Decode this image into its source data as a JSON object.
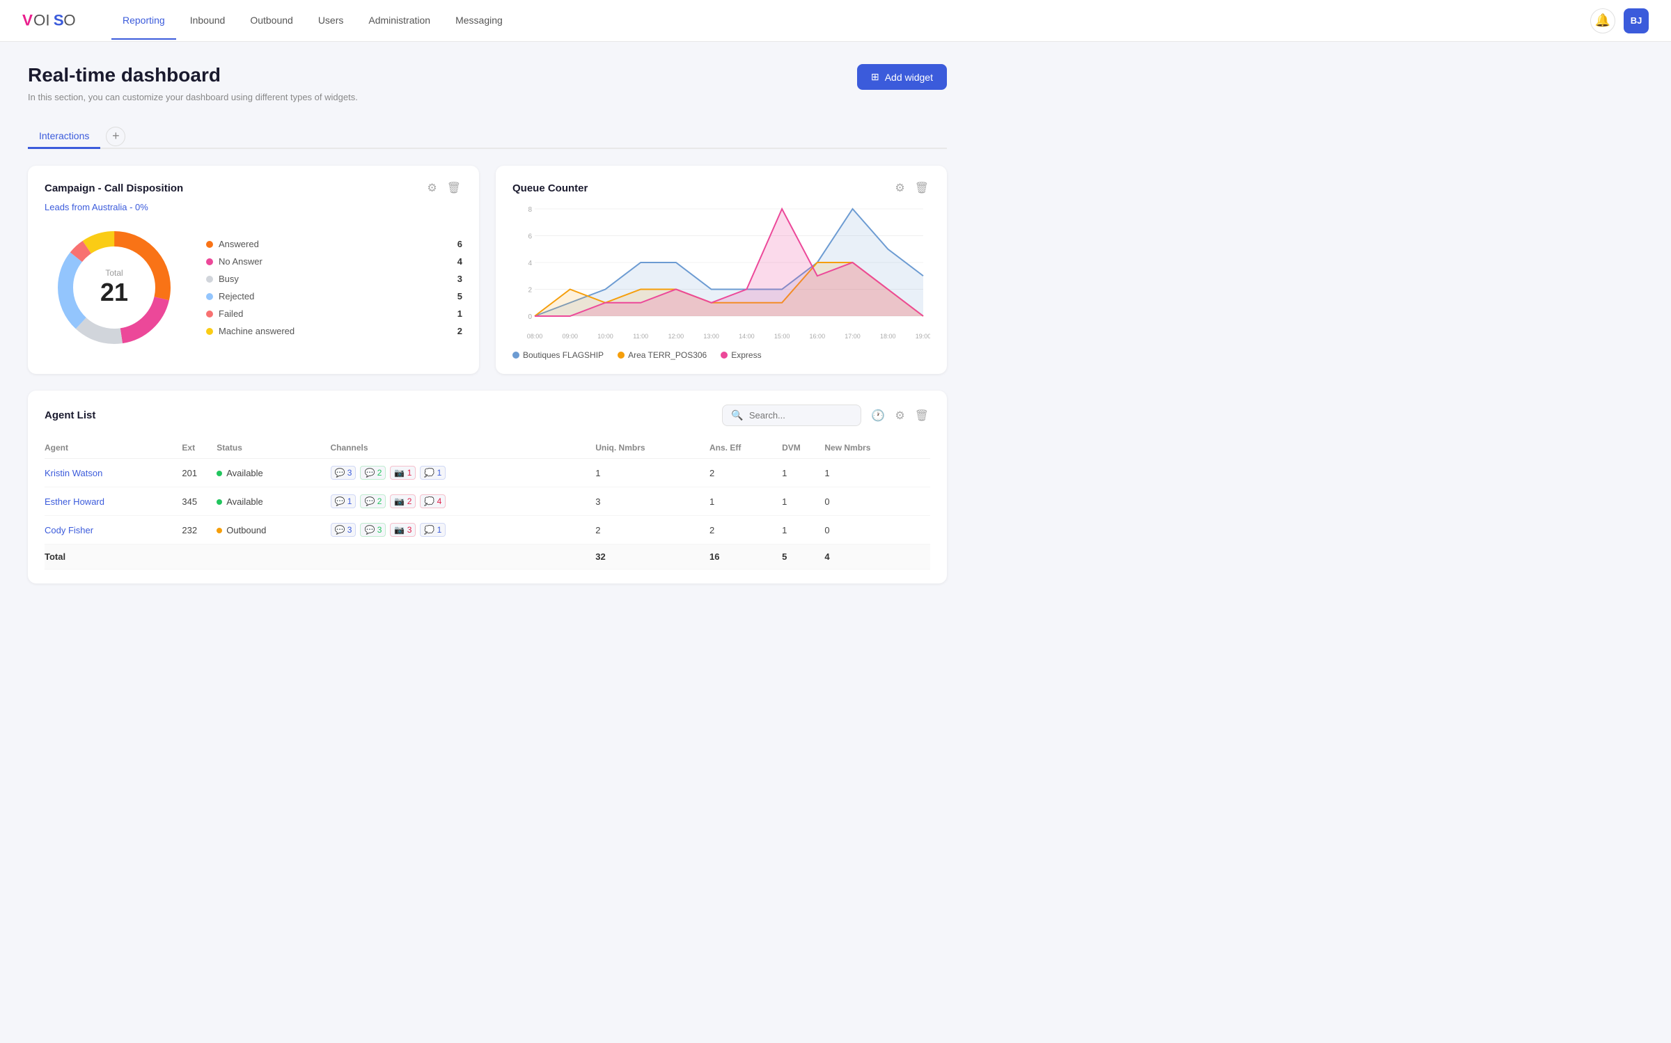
{
  "nav": {
    "links": [
      {
        "label": "Reporting",
        "active": true
      },
      {
        "label": "Inbound",
        "active": false
      },
      {
        "label": "Outbound",
        "active": false
      },
      {
        "label": "Users",
        "active": false
      },
      {
        "label": "Administration",
        "active": false
      },
      {
        "label": "Messaging",
        "active": false
      }
    ],
    "avatar": "BJ"
  },
  "page": {
    "title": "Real-time dashboard",
    "subtitle": "In this section, you can customize your dashboard using different types of widgets.",
    "add_widget_label": "Add widget"
  },
  "tabs": [
    {
      "label": "Interactions",
      "active": true
    }
  ],
  "campaign_card": {
    "title": "Campaign - Call Disposition",
    "link_text": "Leads from Australia - 0%",
    "total_label": "Total",
    "total_value": "21",
    "legend": [
      {
        "label": "Answered",
        "value": 6,
        "color": "#f97316"
      },
      {
        "label": "No Answer",
        "value": 4,
        "color": "#ec4899"
      },
      {
        "label": "Busy",
        "value": 3,
        "color": "#d1d5db"
      },
      {
        "label": "Rejected",
        "value": 5,
        "color": "#93c5fd"
      },
      {
        "label": "Failed",
        "value": 1,
        "color": "#f87171"
      },
      {
        "label": "Machine answered",
        "value": 2,
        "color": "#facc15"
      }
    ],
    "donut": {
      "segments": [
        {
          "color": "#f97316",
          "percent": 28.6
        },
        {
          "color": "#ec4899",
          "percent": 19.0
        },
        {
          "color": "#d1d5db",
          "percent": 14.3
        },
        {
          "color": "#93c5fd",
          "percent": 23.8
        },
        {
          "color": "#f87171",
          "percent": 4.8
        },
        {
          "color": "#facc15",
          "percent": 9.5
        }
      ]
    }
  },
  "queue_card": {
    "title": "Queue Counter",
    "x_labels": [
      "08:00",
      "09:00",
      "10:00",
      "11:00",
      "12:00",
      "13:00",
      "14:00",
      "15:00",
      "16:00",
      "17:00",
      "18:00",
      "19:00"
    ],
    "y_labels": [
      "0",
      "2",
      "4",
      "6",
      "8"
    ],
    "series": [
      {
        "name": "Boutiques FLAGSHIP",
        "color": "#6c9bd2",
        "fill": "rgba(108,155,210,0.15)",
        "points": [
          0,
          1,
          2,
          4,
          4,
          2,
          2,
          2,
          4,
          8,
          5,
          3
        ]
      },
      {
        "name": "Area TERR_POS306",
        "color": "#f59e0b",
        "fill": "rgba(245,158,11,0.15)",
        "points": [
          0,
          2,
          1,
          2,
          2,
          1,
          1,
          1,
          4,
          4,
          2,
          0
        ]
      },
      {
        "name": "Express",
        "color": "#ec4899",
        "fill": "rgba(236,72,153,0.2)",
        "points": [
          0,
          0,
          1,
          1,
          2,
          1,
          2,
          8,
          3,
          4,
          2,
          0
        ]
      }
    ]
  },
  "agent_list": {
    "title": "Agent List",
    "search_placeholder": "Search...",
    "columns": [
      "Agent",
      "Ext",
      "Status",
      "Channels",
      "Uniq. Nmbrs",
      "Ans. Eff",
      "DVM",
      "New Nmbrs"
    ],
    "rows": [
      {
        "name": "Kristin Watson",
        "ext": "201",
        "status": "Available",
        "status_type": "available",
        "channels": [
          {
            "type": "chat",
            "count": 3
          },
          {
            "type": "whatsapp",
            "count": 2
          },
          {
            "type": "instagram",
            "count": 1
          },
          {
            "type": "messenger",
            "count": 1
          }
        ],
        "uniq": 1,
        "ans_eff": 2,
        "dvm": 1,
        "new_nmbrs": 1
      },
      {
        "name": "Esther Howard",
        "ext": "345",
        "status": "Available",
        "status_type": "available",
        "channels": [
          {
            "type": "chat",
            "count": 1
          },
          {
            "type": "whatsapp",
            "count": 2
          },
          {
            "type": "instagram",
            "count": 2
          },
          {
            "type": "messenger",
            "count": 4
          }
        ],
        "uniq": 3,
        "ans_eff": 1,
        "dvm": 1,
        "new_nmbrs": 0
      },
      {
        "name": "Cody Fisher",
        "ext": "232",
        "status": "Outbound",
        "status_type": "outbound",
        "channels": [
          {
            "type": "chat",
            "count": 3
          },
          {
            "type": "whatsapp",
            "count": 3
          },
          {
            "type": "instagram",
            "count": 3
          },
          {
            "type": "messenger",
            "count": 1
          }
        ],
        "uniq": 2,
        "ans_eff": 2,
        "dvm": 1,
        "new_nmbrs": 0
      }
    ],
    "totals": {
      "label": "Total",
      "uniq": 32,
      "ans_eff": 16,
      "dvm": 5,
      "new_nmbrs": 4
    }
  }
}
